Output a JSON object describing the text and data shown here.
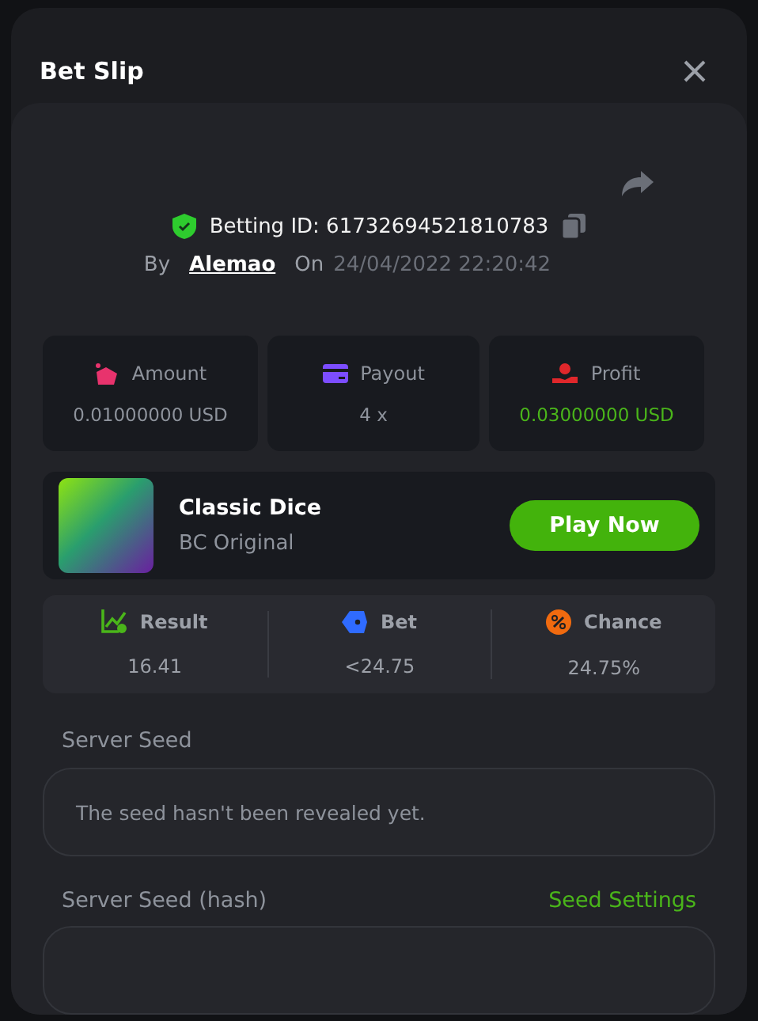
{
  "dialog": {
    "title": "Bet Slip"
  },
  "bet": {
    "id_label": "Betting ID: 61732694521810783",
    "by_label": "By",
    "user": "Alemao",
    "on_label": "On",
    "date": "24/04/2022 22:20:42"
  },
  "stats": [
    {
      "kind": "amount",
      "label": "Amount",
      "value": "0.01000000 USD",
      "positive": false
    },
    {
      "kind": "payout",
      "label": "Payout",
      "value": "4 x",
      "positive": false
    },
    {
      "kind": "profit",
      "label": "Profit",
      "value": "0.03000000 USD",
      "positive": true
    }
  ],
  "game": {
    "name": "Classic Dice",
    "provider": "BC Original",
    "play_button": "Play Now"
  },
  "results": [
    {
      "kind": "result",
      "label": "Result",
      "value": "16.41"
    },
    {
      "kind": "bet",
      "label": "Bet",
      "value": "<24.75"
    },
    {
      "kind": "chance",
      "label": "Chance",
      "value": "24.75%"
    }
  ],
  "server_seed": {
    "label": "Server Seed",
    "value": "The seed hasn't been revealed yet."
  },
  "server_seed_hash": {
    "label": "Server Seed (hash)",
    "link": "Seed Settings"
  }
}
